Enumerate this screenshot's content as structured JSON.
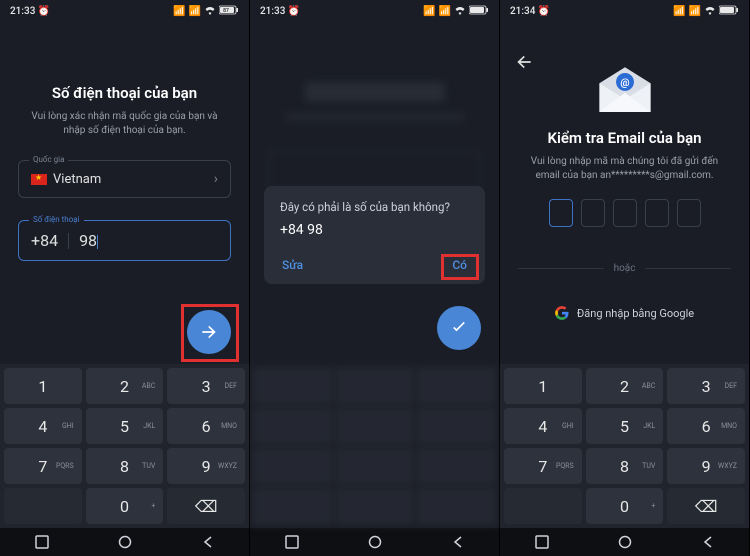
{
  "screens": {
    "s1": {
      "status": {
        "time": "21:33",
        "alarm": true,
        "battery": "87"
      },
      "title": "Số điện thoại của bạn",
      "subtitle": "Vui lòng xác nhận mã quốc gia của bạn và nhập số điện thoại của bạn.",
      "country_label": "Quốc gia",
      "country_value": "Vietnam",
      "phone_label": "Số điện thoại",
      "phone_code": "+84",
      "phone_value": "98"
    },
    "s2": {
      "status": {
        "time": "21:33",
        "alarm": true,
        "battery": "87"
      },
      "dialog_title": "Đây có phải là số của bạn không?",
      "dialog_value": "+84 98",
      "edit_label": "Sửa",
      "yes_label": "Có"
    },
    "s3": {
      "status": {
        "time": "21:34",
        "alarm": true,
        "battery": "87"
      },
      "title": "Kiểm tra Email của bạn",
      "subtitle": "Vui lòng nhập mã mà chúng tôi đã gửi đến email của bạn an*********s@gmail.com.",
      "or_label": "hoặc",
      "google_label": "Đăng nhập bằng Google"
    }
  },
  "keypad": {
    "keys": [
      {
        "n": "1",
        "l": ""
      },
      {
        "n": "2",
        "l": "ABC"
      },
      {
        "n": "3",
        "l": "DEF"
      },
      {
        "n": "4",
        "l": "GHI"
      },
      {
        "n": "5",
        "l": "JKL"
      },
      {
        "n": "6",
        "l": "MNO"
      },
      {
        "n": "7",
        "l": "PQRS"
      },
      {
        "n": "8",
        "l": "TUV"
      },
      {
        "n": "9",
        "l": "WXYZ"
      },
      {
        "n": "",
        "l": ""
      },
      {
        "n": "0",
        "l": "+"
      },
      {
        "n": "⌫",
        "l": ""
      }
    ]
  },
  "colors": {
    "accent": "#4a86d6",
    "highlight": "#e03030"
  }
}
